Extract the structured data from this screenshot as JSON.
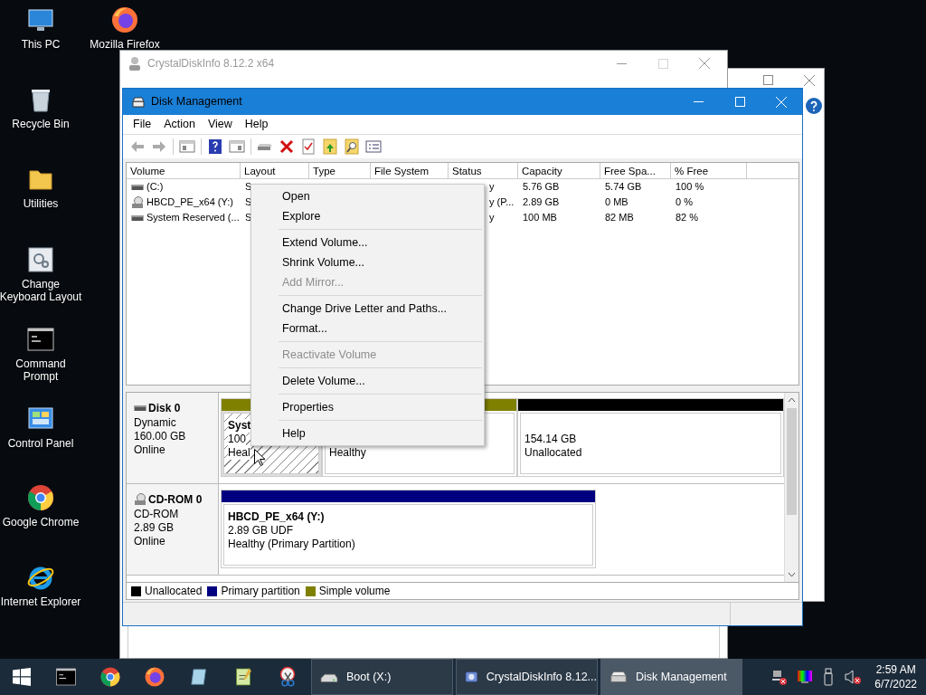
{
  "desktop_icons": [
    {
      "label": "This PC",
      "kind": "pc"
    },
    {
      "label": "Recycle Bin",
      "kind": "bin"
    },
    {
      "label": "Utilities",
      "kind": "folder"
    },
    {
      "label": "Change Keyboard Layout",
      "kind": "keyboard"
    },
    {
      "label": "Command Prompt",
      "kind": "cmd"
    },
    {
      "label": "Control Panel",
      "kind": "panel"
    },
    {
      "label": "Google Chrome",
      "kind": "chrome"
    },
    {
      "label": "Internet Explorer",
      "kind": "ie"
    },
    {
      "label": "Mozilla Firefox",
      "kind": "firefox"
    }
  ],
  "crystaldiskinfo": {
    "title": "CrystalDiskInfo 8.12.2 x64"
  },
  "disk_management": {
    "title": "Disk Management",
    "menu": [
      "File",
      "Action",
      "View",
      "Help"
    ],
    "columns": [
      "Volume",
      "Layout",
      "Type",
      "File System",
      "Status",
      "Capacity",
      "Free Spa...",
      "% Free"
    ],
    "rows": [
      {
        "kind": "disk",
        "volume": "(C:)",
        "layout": "S",
        "status": "y",
        "capacity": "5.76 GB",
        "free_space": "5.74 GB",
        "percent_free": "100 %"
      },
      {
        "kind": "cd",
        "volume": "HBCD_PE_x64 (Y:)",
        "layout": "S",
        "status": "y (P...",
        "capacity": "2.89 GB",
        "free_space": "0 MB",
        "percent_free": "0 %"
      },
      {
        "kind": "disk",
        "volume": "System Reserved (...",
        "layout": "S",
        "status": "y",
        "capacity": "100 MB",
        "free_space": "82 MB",
        "percent_free": "82 %"
      }
    ],
    "disks": [
      {
        "kind": "disk",
        "name": "Disk 0",
        "type": "Dynamic",
        "size": "160.00 GB",
        "state": "Online",
        "partitions": [
          {
            "color": "#808000",
            "selected": true,
            "title": "Syst",
            "lines": [
              "100",
              "Heal"
            ]
          },
          {
            "color": "#808000",
            "selected": false,
            "lines": [
              "Healthy"
            ]
          },
          {
            "color": "#000000",
            "selected": false,
            "lines": [
              "154.14 GB",
              "Unallocated"
            ]
          }
        ]
      },
      {
        "kind": "cd",
        "name": "CD-ROM 0",
        "type": "CD-ROM",
        "size": "2.89 GB",
        "state": "Online",
        "partitions": [
          {
            "color": "#000080",
            "selected": false,
            "title": "HBCD_PE_x64  (Y:)",
            "lines": [
              "2.89 GB UDF",
              "Healthy (Primary Partition)"
            ]
          }
        ]
      }
    ],
    "legend": [
      {
        "label": "Unallocated",
        "color": "#000000"
      },
      {
        "label": "Primary partition",
        "color": "#000080"
      },
      {
        "label": "Simple volume",
        "color": "#808000"
      }
    ]
  },
  "context_menu": {
    "items": [
      {
        "kind": "item",
        "label": "Open",
        "disabled": false
      },
      {
        "kind": "item",
        "label": "Explore",
        "disabled": false
      },
      {
        "kind": "separator"
      },
      {
        "kind": "item",
        "label": "Extend Volume...",
        "disabled": false
      },
      {
        "kind": "item",
        "label": "Shrink Volume...",
        "disabled": false
      },
      {
        "kind": "item",
        "label": "Add Mirror...",
        "disabled": true
      },
      {
        "kind": "separator"
      },
      {
        "kind": "item",
        "label": "Change Drive Letter and Paths...",
        "disabled": false
      },
      {
        "kind": "item",
        "label": "Format...",
        "disabled": false
      },
      {
        "kind": "separator"
      },
      {
        "kind": "item",
        "label": "Reactivate Volume",
        "disabled": true
      },
      {
        "kind": "separator"
      },
      {
        "kind": "item",
        "label": "Delete Volume...",
        "disabled": false
      },
      {
        "kind": "separator"
      },
      {
        "kind": "item",
        "label": "Properties",
        "disabled": false
      },
      {
        "kind": "separator"
      },
      {
        "kind": "item",
        "label": "Help",
        "disabled": false
      }
    ]
  },
  "taskbar": {
    "tasks": [
      {
        "label": "Boot (X:)",
        "kind": "drive",
        "selected": false
      },
      {
        "label": "CrystalDiskInfo 8.12...",
        "kind": "crystal",
        "selected": false
      },
      {
        "label": "Disk Management",
        "kind": "diskmgmt",
        "selected": true
      }
    ],
    "clock": {
      "time": "2:59 AM",
      "date": "6/7/2022"
    }
  }
}
